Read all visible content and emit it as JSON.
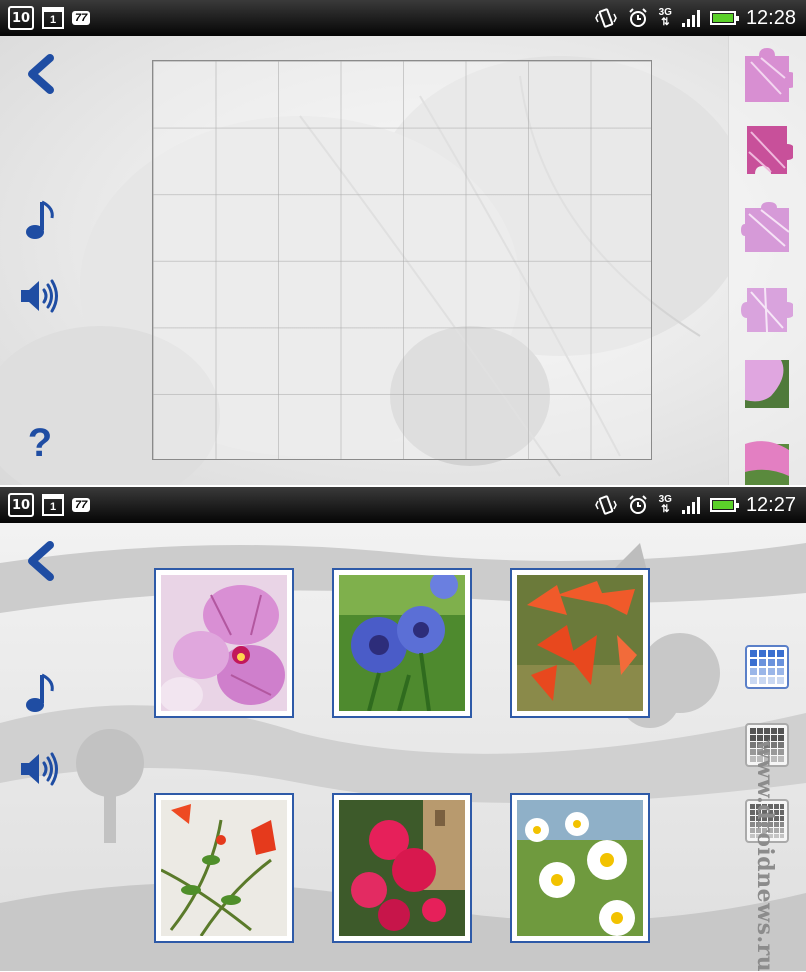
{
  "screens": [
    {
      "statusbar": {
        "date_icon": "10",
        "calendar_icon": "1",
        "notification_badge": "77",
        "network": "3G",
        "time": "12:28"
      },
      "controls": [
        "back-icon",
        "music-note-icon",
        "speaker-icon",
        "help-icon"
      ],
      "help_label": "?",
      "tray_pieces": 6
    },
    {
      "statusbar": {
        "date_icon": "10",
        "calendar_icon": "1",
        "notification_badge": "77",
        "network": "3G",
        "time": "12:27"
      },
      "controls": [
        "back-icon",
        "music-note-icon",
        "speaker-icon"
      ],
      "images": [
        "pink-orchid",
        "blue-cornflowers",
        "red-coral-flowers",
        "red-pomegranate-flowers",
        "pink-oleander",
        "white-daisies"
      ],
      "grid_options": [
        "4x4 grid (selected)",
        "5x5 grid",
        "6x6 grid"
      ]
    }
  ],
  "watermark": "www.droidnews.ru",
  "colors": {
    "accent_blue": "#2e5aa8",
    "statusbar": "#111111",
    "battery": "#5bd12a"
  }
}
